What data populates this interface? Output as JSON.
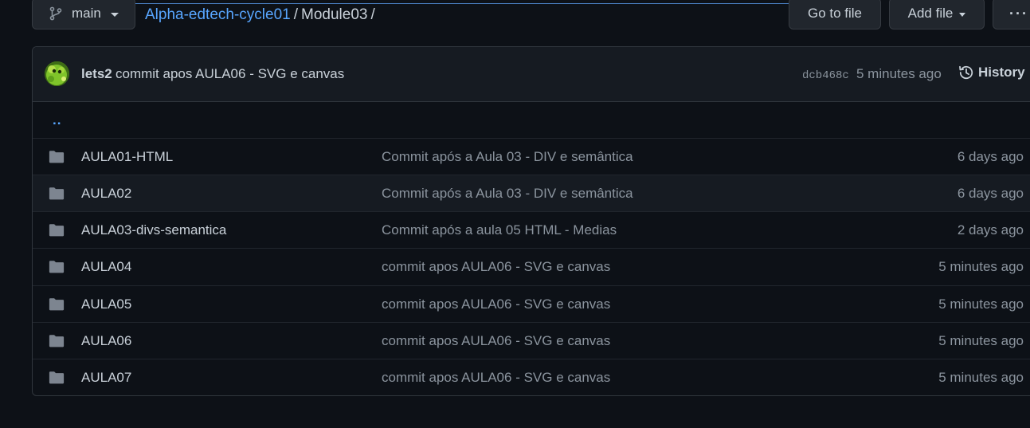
{
  "toolbar": {
    "branch_label": "main",
    "goto_file_label": "Go to file",
    "add_file_label": "Add file",
    "more_label": "···"
  },
  "breadcrumb": {
    "repo": "Alpha-edtech-cycle01",
    "separator": "/",
    "current": "Module03",
    "trailing": "/"
  },
  "latest_commit": {
    "author": "lets2",
    "message": "commit apos AULA06 - SVG e canvas",
    "sha": "dcb468c",
    "time": "5 minutes ago",
    "history_label": "History"
  },
  "parent_dir_label": "..",
  "files": [
    {
      "name": "AULA01-HTML",
      "commit": "Commit após a Aula 03 - DIV e semântica",
      "age": "6 days ago"
    },
    {
      "name": "AULA02",
      "commit": "Commit após a Aula 03 - DIV e semântica",
      "age": "6 days ago"
    },
    {
      "name": "AULA03-divs-semantica",
      "commit": "Commit após a aula 05 HTML - Medias",
      "age": "2 days ago"
    },
    {
      "name": "AULA04",
      "commit": "commit apos AULA06 - SVG e canvas",
      "age": "5 minutes ago"
    },
    {
      "name": "AULA05",
      "commit": "commit apos AULA06 - SVG e canvas",
      "age": "5 minutes ago"
    },
    {
      "name": "AULA06",
      "commit": "commit apos AULA06 - SVG e canvas",
      "age": "5 minutes ago"
    },
    {
      "name": "AULA07",
      "commit": "commit apos AULA06 - SVG e canvas",
      "age": "5 minutes ago"
    }
  ],
  "colors": {
    "background": "#0d1117",
    "link": "#58a6ff",
    "muted": "#8b949e",
    "text": "#c9d1d9",
    "border": "#30363d"
  },
  "icons": {
    "branch": "git-branch-icon",
    "folder": "folder-icon",
    "history": "history-clock-icon",
    "more": "kebab-horizontal-icon"
  }
}
